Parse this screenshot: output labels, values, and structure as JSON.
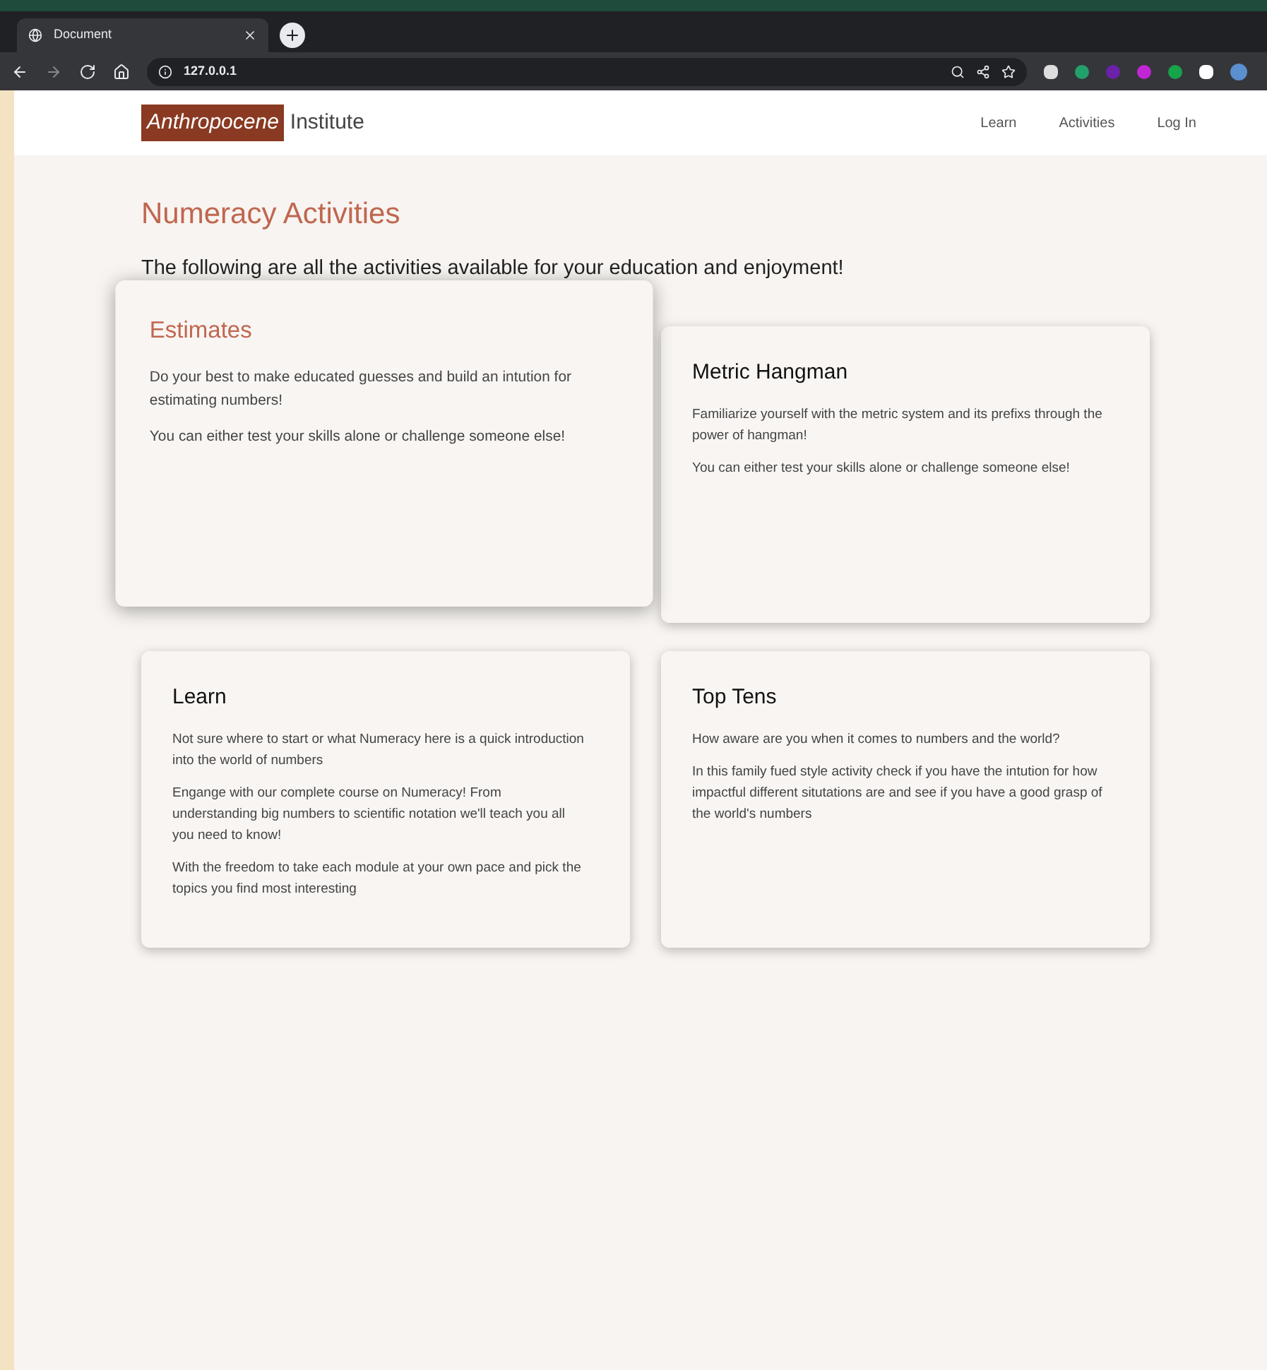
{
  "browser": {
    "tab_title": "Document",
    "url": "127.0.0.1"
  },
  "header": {
    "logo_main": "Anthropocene",
    "logo_rest": "Institute",
    "nav": [
      "Learn",
      "Activities",
      "Log In"
    ]
  },
  "page": {
    "title": "Numeracy Activities",
    "subtitle": "The following are all the activities available for your education and enjoyment!"
  },
  "cards": [
    {
      "title": "Estimates",
      "highlighted": true,
      "paragraphs": [
        "Do your best to make educated guesses and build an intution for estimating numbers!",
        "You can either test your skills alone or challenge someone else!"
      ]
    },
    {
      "title": "Metric Hangman",
      "highlighted": false,
      "paragraphs": [
        "Familiarize yourself with the metric system and its prefixs through the power of hangman!",
        "You can either test your skills alone or challenge someone else!"
      ]
    },
    {
      "title": "Learn",
      "highlighted": false,
      "paragraphs": [
        "Not sure where to start or what Numeracy here is a quick introduction into the world of numbers",
        "Engange with our complete course on Numeracy! From understanding big numbers to scientific notation we'll teach you all you need to know!",
        "With the freedom to take each module at your own pace and pick the topics you find most interesting"
      ]
    },
    {
      "title": "Top Tens",
      "highlighted": false,
      "paragraphs": [
        "How aware are you when it comes to numbers and the world?",
        "In this family fued style activity check if you have the intution for how impactful different situtations are and see if you have a good grasp of the world's numbers"
      ]
    }
  ]
}
